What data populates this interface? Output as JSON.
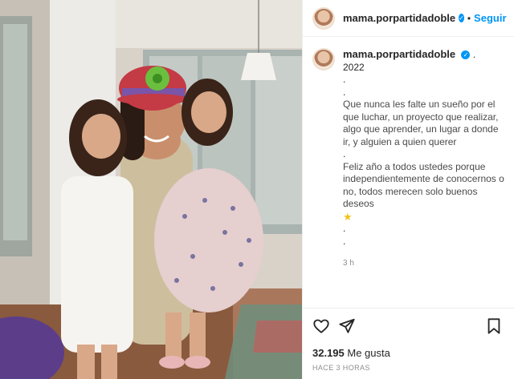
{
  "post": {
    "photo_alt": "",
    "author": "mama.porpartidadoble",
    "verified_icon": "verified-badge-icon",
    "follow_label": "Seguir",
    "header_separator": "•"
  },
  "caption": {
    "username": "mama.porpartidadoble",
    "lines": [
      "2022 ",
      ".",
      ".",
      "Que nunca les falte un sueño por el que luchar, un proyecto que realizar, algo que aprender, un lugar a donde ir, y alguien a quien querer",
      ".",
      "Feliz año a todos ustedes porque independientemente de conocernos o no, todos merecen solo buenos deseos",
      "",
      ".",
      "."
    ],
    "time_ago": "3 h"
  },
  "actions": {
    "like_icon": "heart-icon",
    "share_icon": "share-icon",
    "save_icon": "bookmark-icon"
  },
  "stats": {
    "likes_count": "32.195",
    "likes_label": "Me gusta",
    "posted": "HACE 3 HORAS"
  },
  "colors": {
    "accent": "#0095f6",
    "text": "#262626",
    "muted": "#8e8e8e"
  }
}
